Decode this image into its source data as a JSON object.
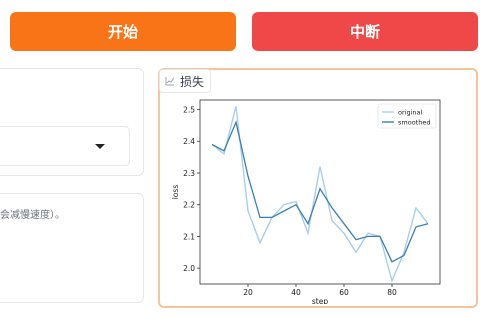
{
  "buttons": {
    "start_label": "开始",
    "stop_label": "中断",
    "start_color": "#f97416",
    "stop_color": "#f04848"
  },
  "left_panel": {
    "dropdown_value": "",
    "hint_text": "会减慢速度）。"
  },
  "plot": {
    "label": "损失",
    "label_icon": "line-chart-icon"
  },
  "chart_data": {
    "type": "line",
    "xlabel": "step",
    "ylabel": "loss",
    "x_ticks": [
      20,
      40,
      60,
      80
    ],
    "y_ticks": [
      2.0,
      2.1,
      2.2,
      2.3,
      2.4,
      2.5
    ],
    "xlim": [
      0,
      100
    ],
    "ylim": [
      1.95,
      2.53
    ],
    "legend_position": "top-right",
    "series": [
      {
        "name": "original",
        "color": "#a9cfe8",
        "x": [
          5,
          10,
          15,
          20,
          25,
          30,
          35,
          40,
          45,
          50,
          55,
          60,
          65,
          70,
          75,
          80,
          85,
          90,
          95
        ],
        "values": [
          2.39,
          2.36,
          2.51,
          2.18,
          2.08,
          2.16,
          2.2,
          2.21,
          2.11,
          2.32,
          2.15,
          2.11,
          2.05,
          2.11,
          2.1,
          1.96,
          2.05,
          2.19,
          2.14
        ]
      },
      {
        "name": "smoothed",
        "color": "#3a7fb5",
        "x": [
          5,
          10,
          15,
          20,
          25,
          30,
          35,
          40,
          45,
          50,
          55,
          60,
          65,
          70,
          75,
          80,
          85,
          90,
          95
        ],
        "values": [
          2.39,
          2.37,
          2.46,
          2.29,
          2.16,
          2.16,
          2.18,
          2.2,
          2.14,
          2.25,
          2.19,
          2.14,
          2.09,
          2.1,
          2.1,
          2.02,
          2.04,
          2.13,
          2.14
        ]
      }
    ]
  }
}
